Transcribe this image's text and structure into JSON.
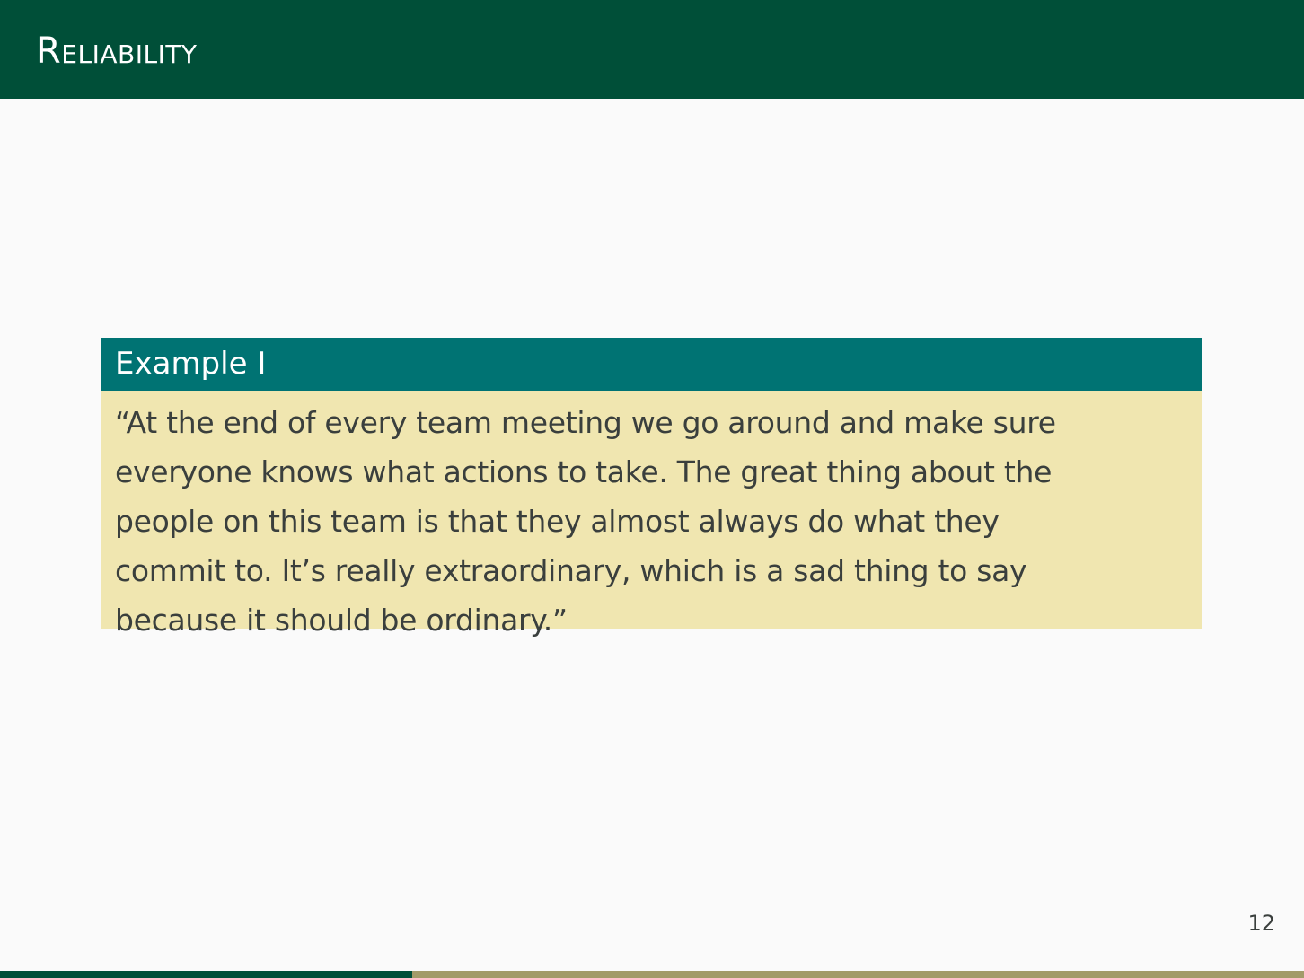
{
  "slide": {
    "title": "Reliability",
    "page_number": "12",
    "progress": 0.316
  },
  "example": {
    "title": "Example I",
    "lines": [
      "“At the end of every team meeting we go around and make sure",
      "everyone knows what actions to take. The great thing about the",
      "people on this team is that they almost always do what they",
      "commit to. It’s really extraordinary, which is a sad thing to say",
      "because it should be ordinary.”"
    ]
  },
  "colors": {
    "header": "#004f38",
    "block_title": "#007373",
    "block_body": "#f0e6b0",
    "progress_track": "#a39b69",
    "progress_fill": "#004f38"
  }
}
